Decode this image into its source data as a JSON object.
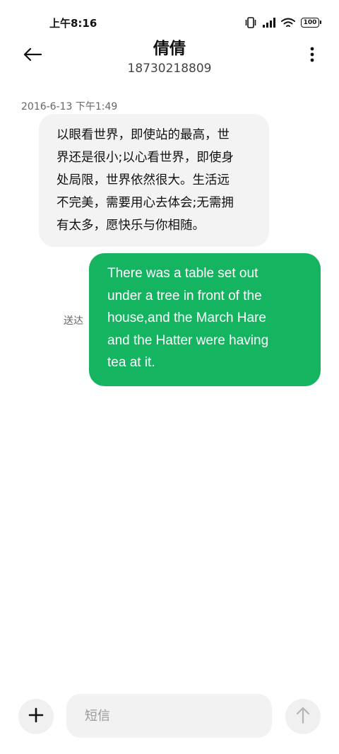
{
  "status_bar": {
    "time": "上午8:16",
    "battery_level": "100",
    "icons": [
      "vibrate-icon",
      "signal-icon",
      "wifi-icon",
      "battery-icon"
    ]
  },
  "header": {
    "contact_name": "倩倩",
    "contact_number": "18730218809",
    "back_icon": "back-arrow-icon",
    "menu_icon": "more-vertical-icon"
  },
  "conversation": {
    "timestamp": "2016-6-13 下午1:49",
    "incoming_message": {
      "lines": [
        "以眼看世界，即使站的最高，世",
        "界还是很小;以心看世界，即使身",
        "处局限，世界依然很大。生活远",
        "不完美，需要用心去体会;无需拥",
        "有太多，愿快乐与你相随。"
      ]
    },
    "outgoing_message": {
      "lines": [
        "There was a table set out",
        "under a tree in front of the",
        "house,and the March Hare",
        "and the Hatter were having",
        "tea at it."
      ],
      "status": "送达"
    }
  },
  "composer": {
    "placeholder": "短信",
    "value": "",
    "add_icon": "plus-icon",
    "send_icon": "arrow-up-icon"
  },
  "colors": {
    "accent": "#14b460",
    "incoming_bubble": "#f3f3f3",
    "control_bg": "#f0f0f0"
  }
}
